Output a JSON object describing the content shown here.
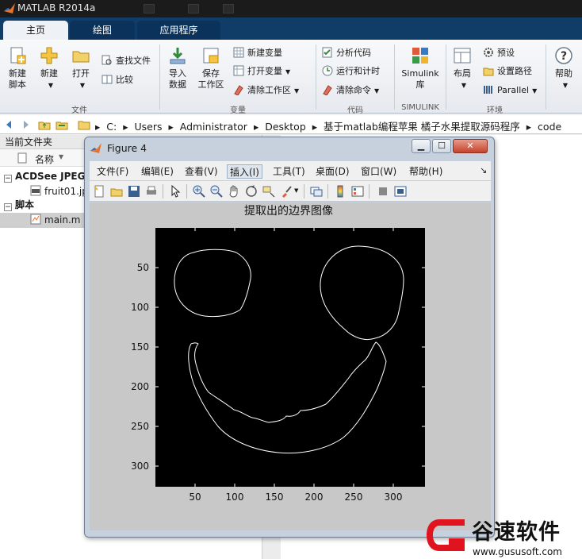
{
  "app": {
    "title": "MATLAB R2014a"
  },
  "tabs": [
    {
      "label": "主页"
    },
    {
      "label": "绘图"
    },
    {
      "label": "应用程序"
    }
  ],
  "ribbon": {
    "new_script": "新建\n脚本",
    "new": "新建",
    "open": "打开",
    "find_files": "查找文件",
    "compare": "比较",
    "file_section": "文件",
    "import_data": "导入\n数据",
    "save_workspace": "保存\n工作区",
    "new_variable": "新建变量",
    "open_variable": "打开变量",
    "clear_workspace": "清除工作区",
    "variable_section": "变量",
    "analyze_code": "分析代码",
    "run_and_time": "运行和计时",
    "clear_commands": "清除命令",
    "code_section": "代码",
    "simulink_library": "Simulink\n库",
    "simulink_section": "SIMULINK",
    "layout": "布局",
    "preferences": "预设",
    "set_path": "设置路径",
    "parallel": "Parallel",
    "environment_section": "环境",
    "help": "帮助"
  },
  "address": {
    "crumbs": [
      "C:",
      "Users",
      "Administrator",
      "Desktop",
      "基于matlab编程苹果 橘子水果提取源码程序",
      "code"
    ]
  },
  "current_folder": {
    "title": "当前文件夹",
    "column_name": "名称",
    "groups": [
      {
        "label": "ACDSee JPEG",
        "file": "fruit01.jpg"
      },
      {
        "label": "脚本",
        "file": "main.m"
      }
    ]
  },
  "figure": {
    "title": "Figure 4",
    "menu": [
      "文件(F)",
      "编辑(E)",
      "查看(V)",
      "插入(I)",
      "工具(T)",
      "桌面(D)",
      "窗口(W)",
      "帮助(H)"
    ],
    "plot_title": "提取出的边界图像",
    "x_ticks": [
      "50",
      "100",
      "150",
      "200",
      "250",
      "300"
    ],
    "y_ticks": [
      "50",
      "100",
      "150",
      "200",
      "250",
      "300"
    ]
  },
  "watermark": {
    "name": "谷速软件",
    "url": "www.gususoft.com"
  },
  "colors": {
    "titlebar": "#1b1b1b",
    "tabstrip": "#0f3d68",
    "plot_bg": "#000000",
    "edge_line": "#ffffff",
    "watermark_red": "#e0141e"
  }
}
